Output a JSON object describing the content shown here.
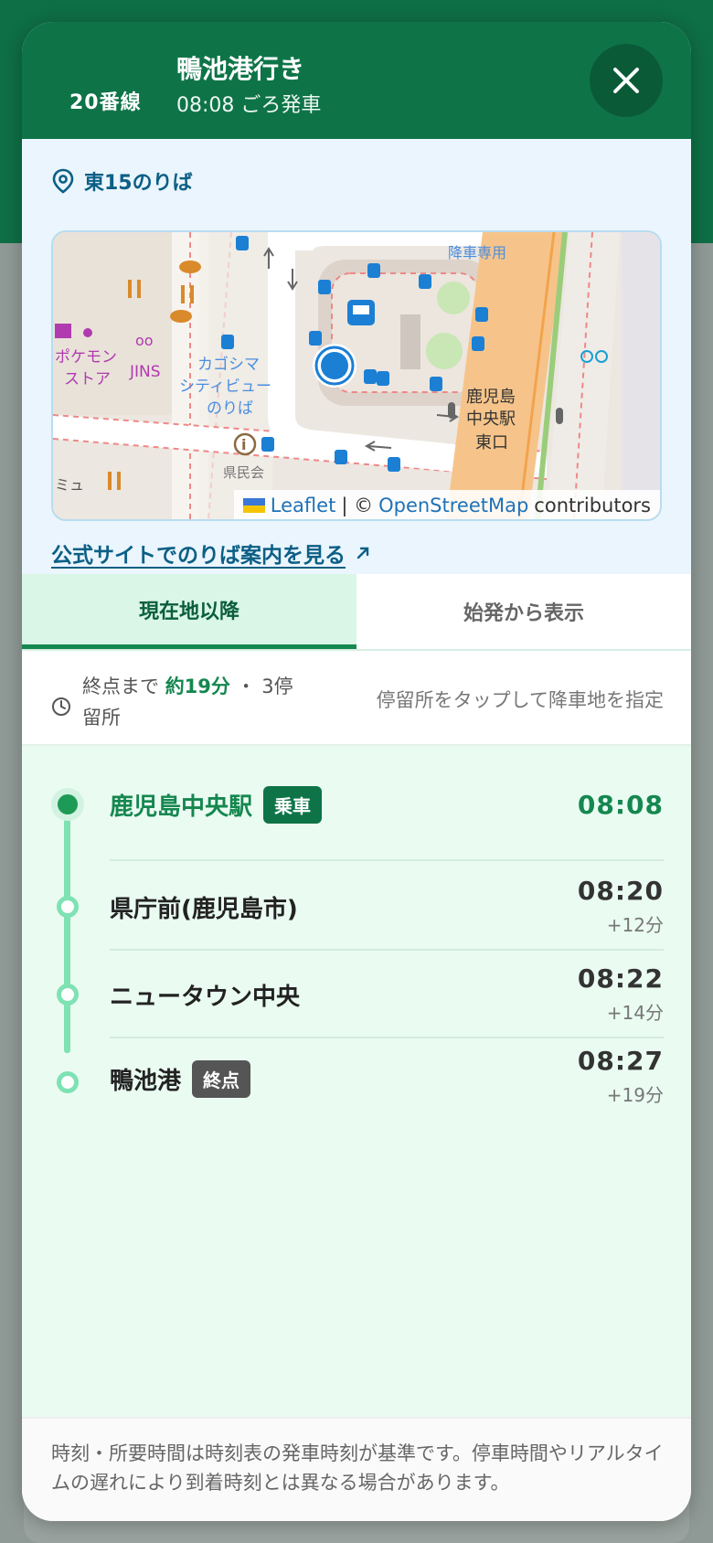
{
  "header": {
    "route_number": "20番線",
    "destination": "鴨池港行き",
    "departure": "08:08 ごろ発車",
    "close_icon": "close-icon"
  },
  "stop_info": {
    "location_icon": "location-pin-icon",
    "stop_label": "東15のりば",
    "map": {
      "labels": {
        "pokemon": "ポケモン\nストア",
        "jins": "JINS",
        "cityview": "カゴシマ\nシティビュー\nのりば",
        "chuo_east": "鹿児島\n中央駅\n東口",
        "drop_only": "降車専用",
        "myu": "ミュ",
        "kenmin": "県民会"
      },
      "attribution_leaflet": "Leaflet",
      "attribution_sep": "| ©",
      "attribution_osm": "OpenStreetMap",
      "attribution_contrib": "contributors"
    },
    "official_link": "公式サイトでのりば案内を見る",
    "external_icon": "external-link-icon"
  },
  "tabs": [
    {
      "label": "現在地以降",
      "active": true
    },
    {
      "label": "始発から表示",
      "active": false
    }
  ],
  "summary": {
    "clock_icon": "clock-icon",
    "prefix": "終点まで",
    "duration": "約19分",
    "sep": "・",
    "stops_line1": "3停",
    "stops_line2": "留所",
    "hint": "停留所をタップして降車地を指定"
  },
  "stops": [
    {
      "name": "鹿児島中央駅",
      "badge": "乗車",
      "time": "08:08",
      "delta": ""
    },
    {
      "name": "県庁前(鹿児島市)",
      "badge": "",
      "time": "08:20",
      "delta": "+12分"
    },
    {
      "name": "ニュータウン中央",
      "badge": "",
      "time": "08:22",
      "delta": "+14分"
    },
    {
      "name": "鴨池港",
      "badge": "終点",
      "time": "08:27",
      "delta": "+19分"
    }
  ],
  "footer": {
    "note": "時刻・所要時間は時刻表の発車時刻が基準です。停車時間やリアルタイムの遅れにより到着時刻とは異なる場合があります。"
  },
  "colors": {
    "brand_green": "#0e7448",
    "accent_green": "#15874f",
    "link_blue": "#0c5f85",
    "map_bus_blue": "#1b7fd4"
  }
}
